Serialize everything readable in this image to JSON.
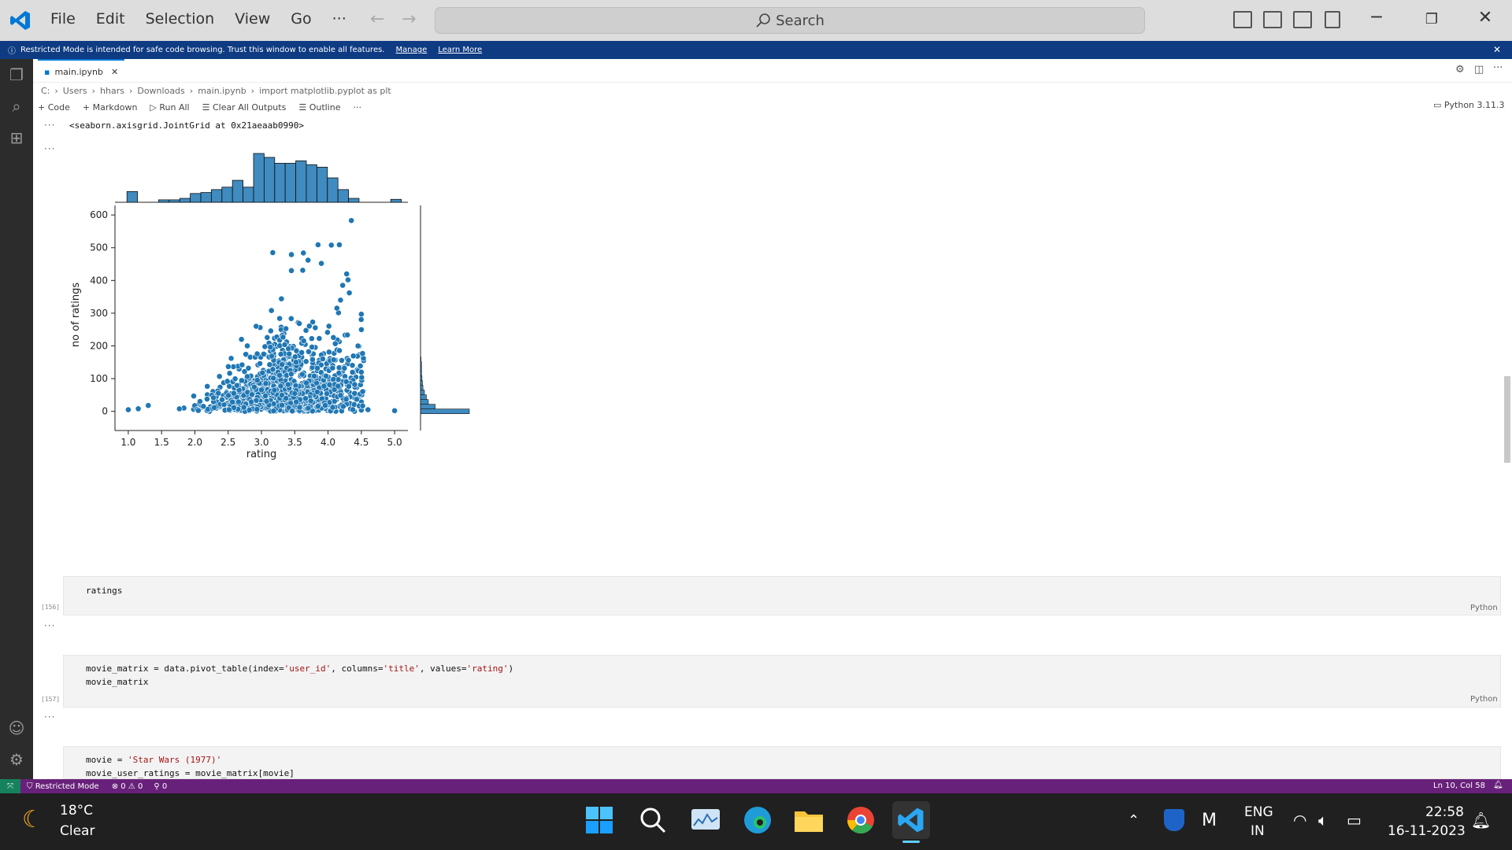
{
  "menu": {
    "file": "File",
    "edit": "Edit",
    "selection": "Selection",
    "view": "View",
    "go": "Go",
    "more": "···",
    "search": "Search"
  },
  "banner": {
    "text": "Restricted Mode is intended for safe code browsing. Trust this window to enable all features.",
    "manage": "Manage",
    "learn_more": "Learn More"
  },
  "tab": {
    "label": "main.ipynb"
  },
  "breadcrumb": [
    "C:",
    "Users",
    "hhars",
    "Downloads",
    "main.ipynb",
    "import matplotlib.pyplot as plt"
  ],
  "notebook_toolbar": {
    "code": "Code",
    "markdown": "Markdown",
    "run_all": "Run All",
    "clear_all": "Clear All Outputs",
    "outline": "Outline",
    "more": "···",
    "kernel": "Python 3.11.3"
  },
  "output": {
    "repr": "<seaborn.axisgrid.JointGrid at 0x21aeaab0990>",
    "ellipsis": "···"
  },
  "chart_data": {
    "type": "scatter",
    "title": "",
    "xlabel": "rating",
    "ylabel": "no of ratings",
    "xlim": [
      0.8,
      5.2
    ],
    "ylim": [
      -20,
      610
    ],
    "xticks": [
      "1.0",
      "1.5",
      "2.0",
      "2.5",
      "3.0",
      "3.5",
      "4.0",
      "4.5",
      "5.0"
    ],
    "yticks": [
      "0",
      "100",
      "200",
      "300",
      "400",
      "500",
      "600"
    ],
    "marginal_x_hist_heights": [
      0.22,
      0.0,
      0.0,
      0.05,
      0.05,
      0.08,
      0.18,
      0.2,
      0.26,
      0.31,
      0.45,
      0.31,
      1.0,
      0.92,
      0.8,
      0.8,
      0.85,
      0.77,
      0.72,
      0.5,
      0.26,
      0.08,
      0.0,
      0.0,
      0.0,
      0.06
    ],
    "marginal_y_hist_widths": [
      1.0,
      0.3,
      0.16,
      0.12,
      0.08,
      0.05,
      0.04,
      0.03,
      0.02,
      0.02,
      0.02,
      0.01
    ],
    "highlighted_points": [
      {
        "x": 4.35,
        "y": 583
      },
      {
        "x": 3.85,
        "y": 509
      },
      {
        "x": 4.05,
        "y": 508
      },
      {
        "x": 4.17,
        "y": 509
      },
      {
        "x": 3.17,
        "y": 485
      },
      {
        "x": 3.45,
        "y": 479
      },
      {
        "x": 3.63,
        "y": 484
      },
      {
        "x": 3.7,
        "y": 462
      },
      {
        "x": 3.9,
        "y": 452
      },
      {
        "x": 3.45,
        "y": 430
      },
      {
        "x": 3.62,
        "y": 431
      },
      {
        "x": 4.28,
        "y": 420
      },
      {
        "x": 4.3,
        "y": 402
      },
      {
        "x": 4.22,
        "y": 385
      },
      {
        "x": 4.32,
        "y": 362
      },
      {
        "x": 3.3,
        "y": 344
      },
      {
        "x": 4.5,
        "y": 297
      },
      {
        "x": 3.15,
        "y": 308
      },
      {
        "x": 2.98,
        "y": 256
      },
      {
        "x": 2.92,
        "y": 260
      },
      {
        "x": 2.7,
        "y": 220
      },
      {
        "x": 1.0,
        "y": 5
      },
      {
        "x": 1.15,
        "y": 8
      },
      {
        "x": 1.3,
        "y": 18
      },
      {
        "x": 5.0,
        "y": 2
      },
      {
        "x": 4.6,
        "y": 5
      },
      {
        "x": 4.5,
        "y": 120
      },
      {
        "x": 4.45,
        "y": 200
      }
    ]
  },
  "cells": [
    {
      "exec": "[156]",
      "lines": [
        "ratings"
      ],
      "lang": "Python"
    },
    {
      "exec": "[157]",
      "lines": [
        "movie_matrix = data.pivot_table(index='user_id', columns='title', values='rating')",
        "movie_matrix"
      ],
      "lang": "Python"
    },
    {
      "exec": "",
      "lines": [
        "movie = 'Star Wars (1977)'",
        "movie_user_ratings = movie_matrix[movie]"
      ],
      "lang": ""
    }
  ],
  "status": {
    "mode": "Restricted Mode",
    "problems": "⊗ 0 ⚠ 0",
    "ports": "0",
    "position": "Ln 10, Col 58"
  },
  "weather": {
    "temp": "18°C",
    "cond": "Clear"
  },
  "tray": {
    "lang": "ENG",
    "region": "IN",
    "time": "22:58",
    "date": "16-11-2023"
  },
  "colors": {
    "accent": "#0078d4",
    "banner": "#0e3b82",
    "status": "#68217a",
    "point": "#1f77b4"
  }
}
